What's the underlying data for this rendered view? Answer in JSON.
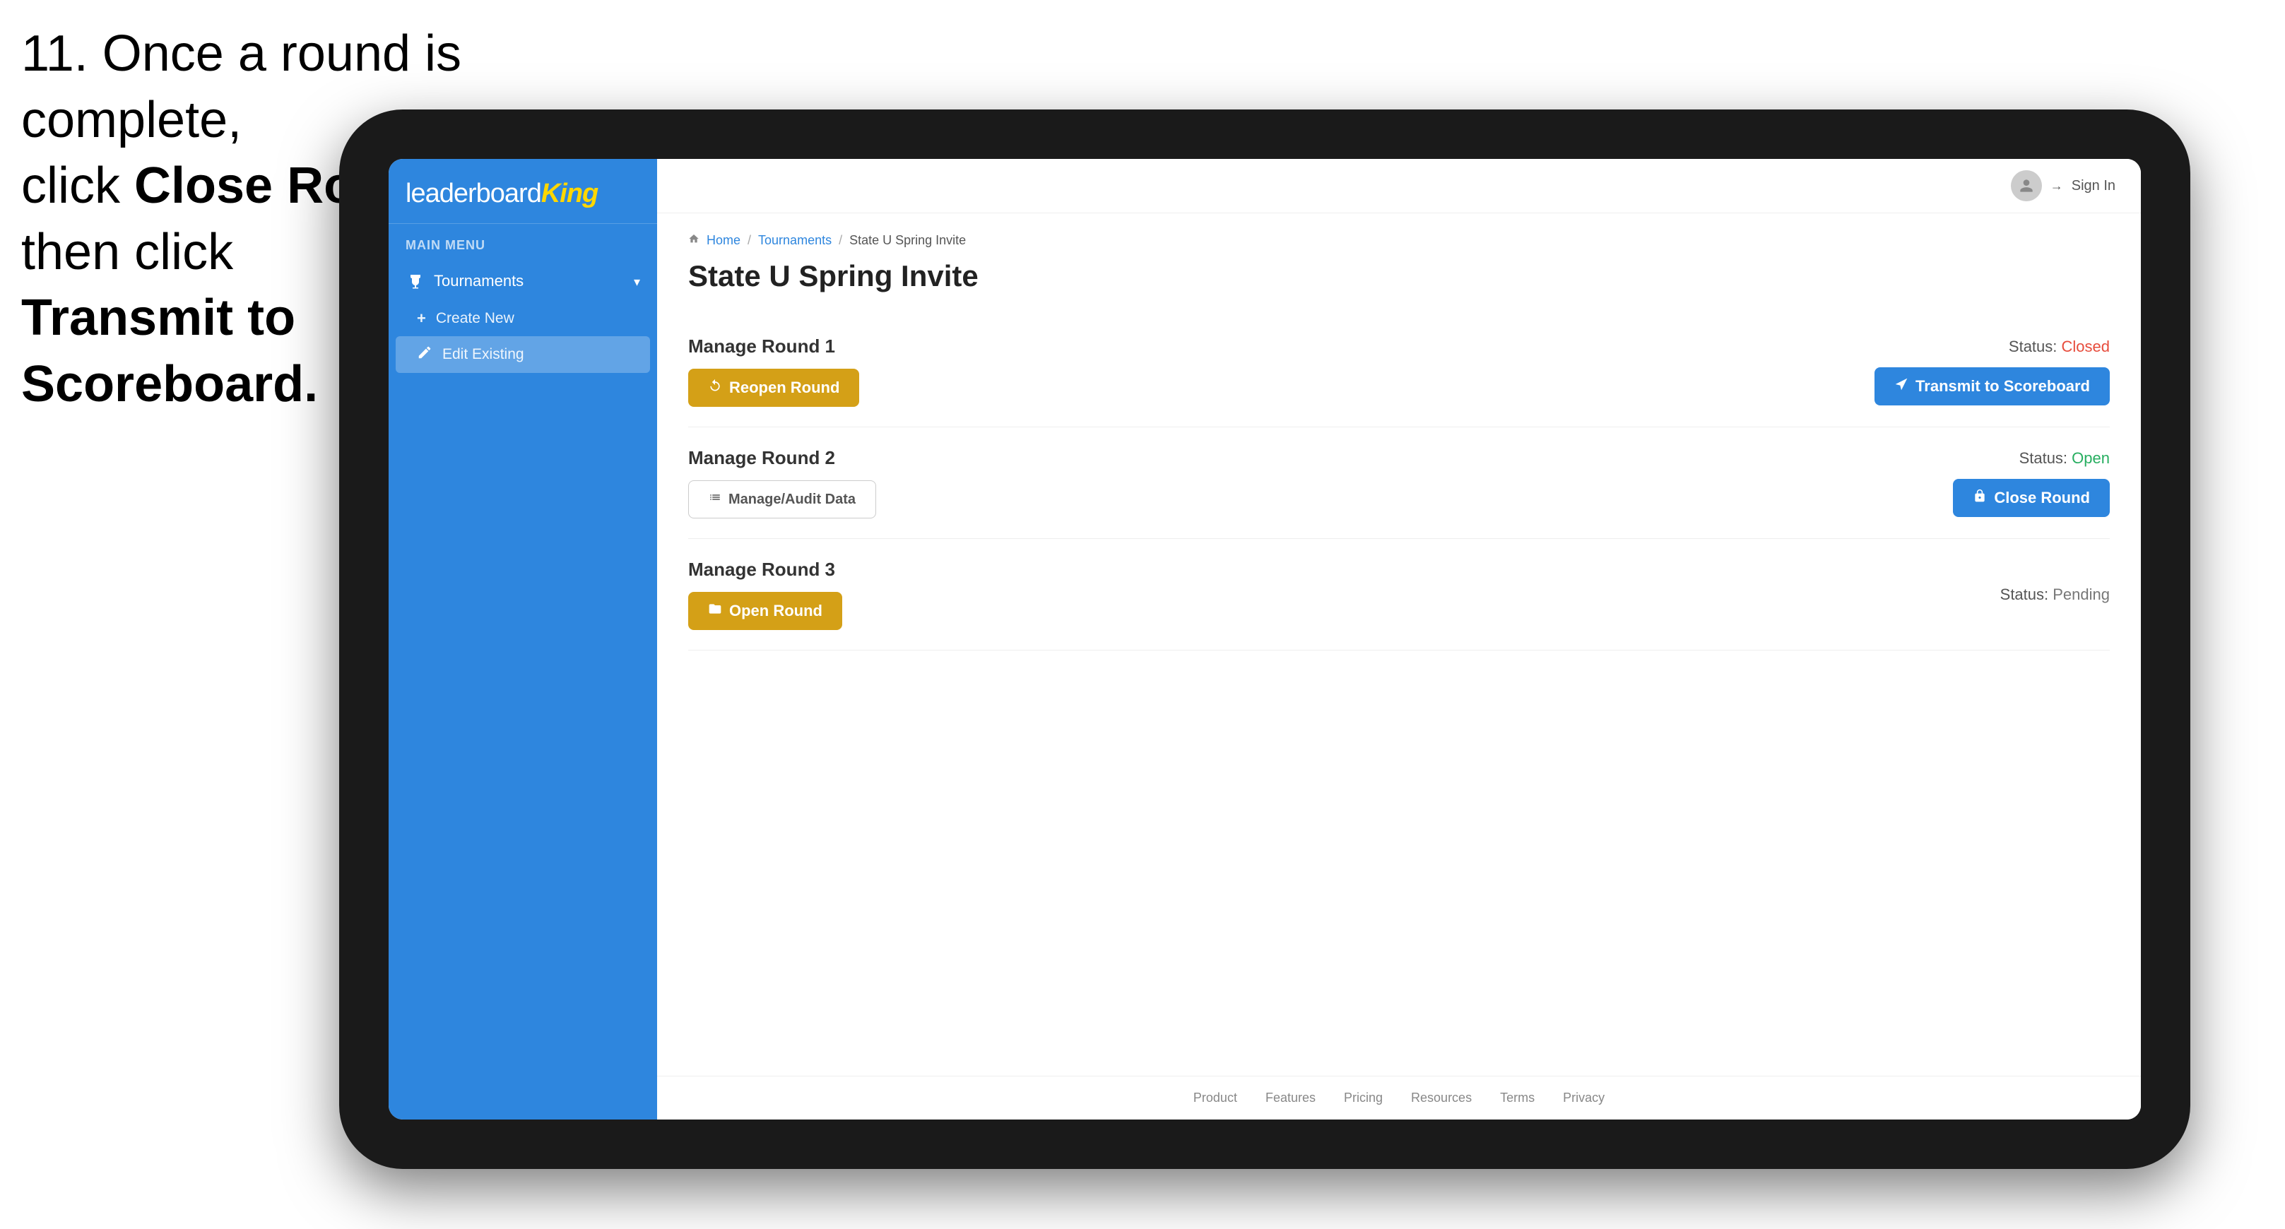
{
  "instruction": {
    "line1": "11. Once a round is complete,",
    "line2": "click ",
    "bold1": "Close Round",
    "line3": " then click",
    "bold2": "Transmit to Scoreboard."
  },
  "app": {
    "logo": {
      "prefix": "leaderboard",
      "suffix": "King"
    },
    "sidebar": {
      "main_menu_label": "MAIN MENU",
      "nav_items": [
        {
          "label": "Tournaments",
          "icon": "trophy-icon",
          "expanded": true
        }
      ],
      "sub_items": [
        {
          "label": "Create New",
          "icon": "plus-icon"
        },
        {
          "label": "Edit Existing",
          "icon": "edit-icon",
          "active": true
        }
      ]
    },
    "topbar": {
      "sign_in_label": "Sign In"
    },
    "breadcrumb": {
      "home": "Home",
      "sep1": "/",
      "tournaments": "Tournaments",
      "sep2": "/",
      "current": "State U Spring Invite"
    },
    "page_title": "State U Spring Invite",
    "rounds": [
      {
        "title": "Manage Round 1",
        "status_label": "Status:",
        "status_value": "Closed",
        "status_class": "status-closed",
        "buttons": [
          {
            "label": "Reopen Round",
            "type": "btn-gold",
            "icon": "reopen-icon"
          },
          {
            "label": "Transmit to Scoreboard",
            "type": "btn-blue",
            "icon": "transmit-icon"
          }
        ]
      },
      {
        "title": "Manage Round 2",
        "status_label": "Status:",
        "status_value": "Open",
        "status_class": "status-open",
        "buttons": [
          {
            "label": "Manage/Audit Data",
            "type": "btn-outline-gray",
            "icon": "audit-icon"
          },
          {
            "label": "Close Round",
            "type": "btn-blue",
            "icon": "close-round-icon"
          }
        ]
      },
      {
        "title": "Manage Round 3",
        "status_label": "Status:",
        "status_value": "Pending",
        "status_class": "status-pending",
        "buttons": [
          {
            "label": "Open Round",
            "type": "btn-gold",
            "icon": "open-round-icon"
          }
        ]
      }
    ],
    "footer": {
      "links": [
        "Product",
        "Features",
        "Pricing",
        "Resources",
        "Terms",
        "Privacy"
      ]
    }
  }
}
